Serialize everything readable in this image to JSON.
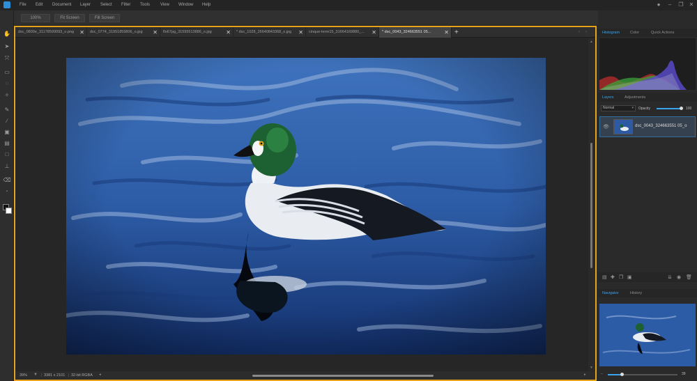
{
  "menubar": {
    "items": [
      "File",
      "Edit",
      "Document",
      "Layer",
      "Select",
      "Filter",
      "Tools",
      "View",
      "Window",
      "Help"
    ]
  },
  "optionsbar": {
    "zoom_label": "100%",
    "fit_label": "Fit Screen",
    "fill_label": "Fill Screen"
  },
  "document_tabs": [
    {
      "label": "dsc_0800e_31178599093_o.png",
      "active": false,
      "modified": false
    },
    {
      "label": "dsc_0774_31951859806_o.jpg",
      "active": false,
      "modified": false
    },
    {
      "label": "flo67pg_31595513886_o.jpg",
      "active": false,
      "modified": false
    },
    {
      "label": "* dsc_1028_26640843368_o.jpg",
      "active": false,
      "modified": true
    },
    {
      "label": "cinque-terre15_31664169880_...",
      "active": false,
      "modified": false
    },
    {
      "label": "* dsc_0043_324663551 05...",
      "active": true,
      "modified": true
    }
  ],
  "statusbar": {
    "zoom": "39%",
    "dimensions": "3381 x 2101",
    "mode": "32-bit RGBA"
  },
  "right_panel": {
    "top_tabs": [
      "Histogram",
      "Color",
      "Quick Actions"
    ],
    "histogram_channels": [
      "R",
      "G",
      "B",
      "L"
    ],
    "layer_tabs": [
      "Layers",
      "Adjustments"
    ],
    "blend_mode": "Normal",
    "opacity_label": "Opacity",
    "opacity_value": "100",
    "layer_name": "dsc_0043_324663551 05_o",
    "bottom_tabs": [
      "Navigator",
      "History"
    ],
    "nav_zoom": "39"
  },
  "colors": {
    "accent": "#3ba4ef",
    "frame": "#e8a31c",
    "water": "#2f5fa8",
    "duck_head": "#1f6b33"
  }
}
